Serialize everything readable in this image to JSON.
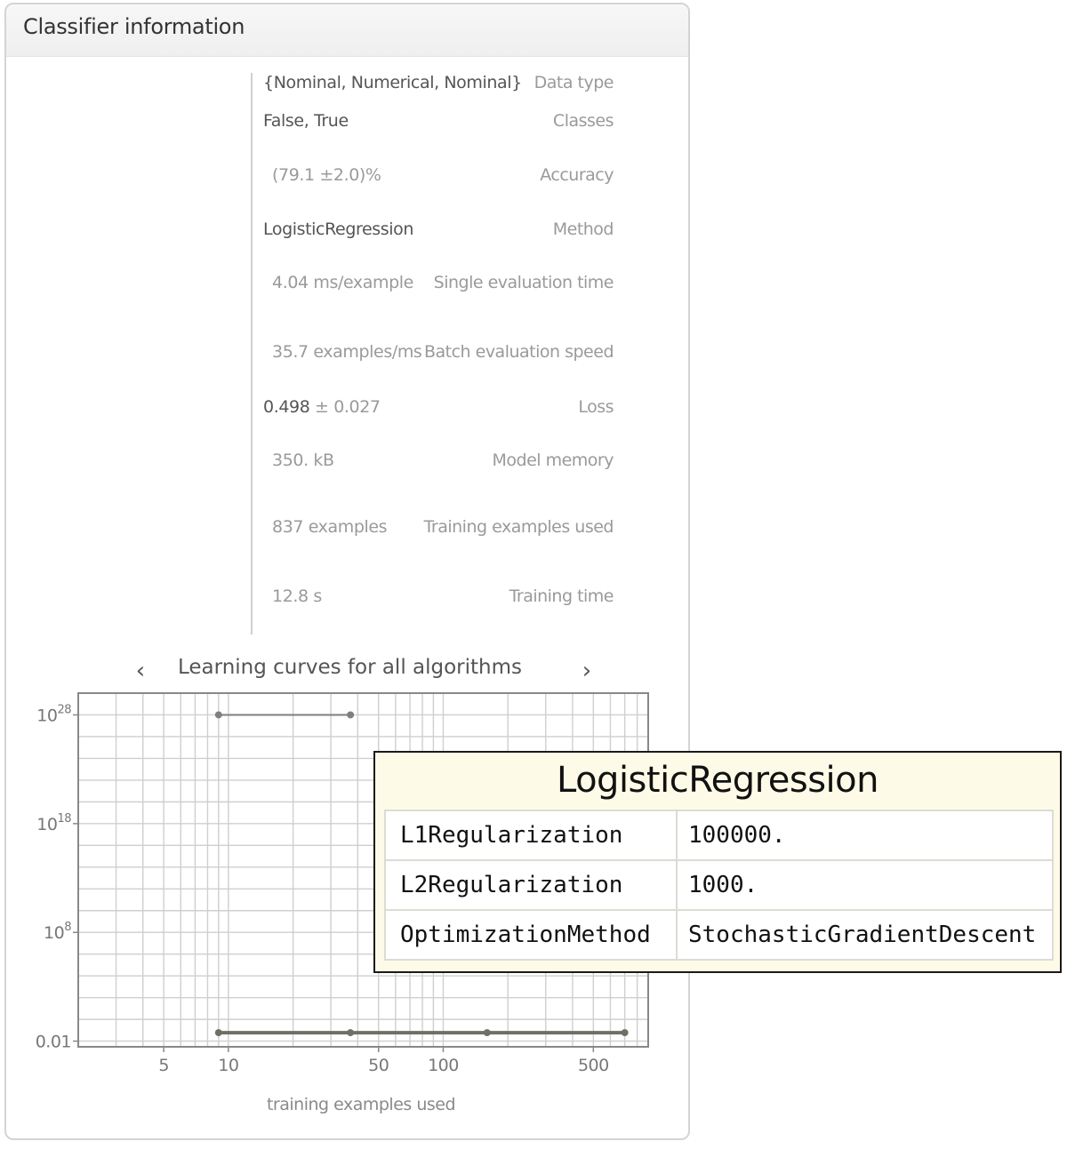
{
  "panel": {
    "title": "Classifier information",
    "rows": [
      {
        "label": "Data type",
        "value": "{Nominal, Numerical, Nominal}"
      },
      {
        "label": "Classes",
        "value": "False, True"
      },
      {
        "label": "Accuracy",
        "value": "(79.1 ±2.0)%"
      },
      {
        "label": "Method",
        "value": "LogisticRegression"
      },
      {
        "label": "Single evaluation time",
        "value": "4.04 ms/example"
      },
      {
        "label": "Batch evaluation speed",
        "value": "35.7 examples/ms"
      },
      {
        "label": "Loss",
        "value": "0.498",
        "value_secondary": "± 0.027"
      },
      {
        "label": "Model memory",
        "value": "350. kB"
      },
      {
        "label": "Training examples used",
        "value": "837 examples"
      },
      {
        "label": "Training time",
        "value": "12.8 s"
      }
    ]
  },
  "learning_curves": {
    "title": "Learning curves for all algorithms",
    "prev_icon": "chevron-left-icon",
    "next_icon": "chevron-right-icon",
    "prev_glyph": "‹",
    "next_glyph": "›"
  },
  "chart_data": {
    "type": "line",
    "xlabel": "training examples used",
    "ylabel": "",
    "xscale": "log",
    "yscale": "log",
    "xlim": [
      2,
      900
    ],
    "ylim": [
      0.003,
      1e+30
    ],
    "x_ticks": [
      5,
      10,
      50,
      100,
      500
    ],
    "x_tick_labels": [
      "5",
      "10",
      "50",
      "100",
      "500"
    ],
    "y_ticks": [
      0.01,
      100000000.0,
      1e+18,
      1e+28
    ],
    "y_tick_labels": [
      {
        "base": "0.01",
        "exp": ""
      },
      {
        "base": "10",
        "exp": "8"
      },
      {
        "base": "10",
        "exp": "18"
      },
      {
        "base": "10",
        "exp": "28"
      }
    ],
    "grid": true,
    "series": [
      {
        "x": [
          9,
          37
        ],
        "y": [
          1e+28,
          1e+28
        ],
        "color": "#7f7f7f"
      },
      {
        "x": [
          9,
          37,
          160,
          700
        ],
        "y": [
          0.06,
          0.06,
          0.06,
          0.06
        ],
        "color": "#6f6f64"
      }
    ]
  },
  "tooltip": {
    "title": "LogisticRegression",
    "rows": [
      {
        "key": "L1Regularization",
        "value": "100000."
      },
      {
        "key": "L2Regularization",
        "value": "1000."
      },
      {
        "key": "OptimizationMethod",
        "value": "StochasticGradientDescent"
      }
    ]
  }
}
